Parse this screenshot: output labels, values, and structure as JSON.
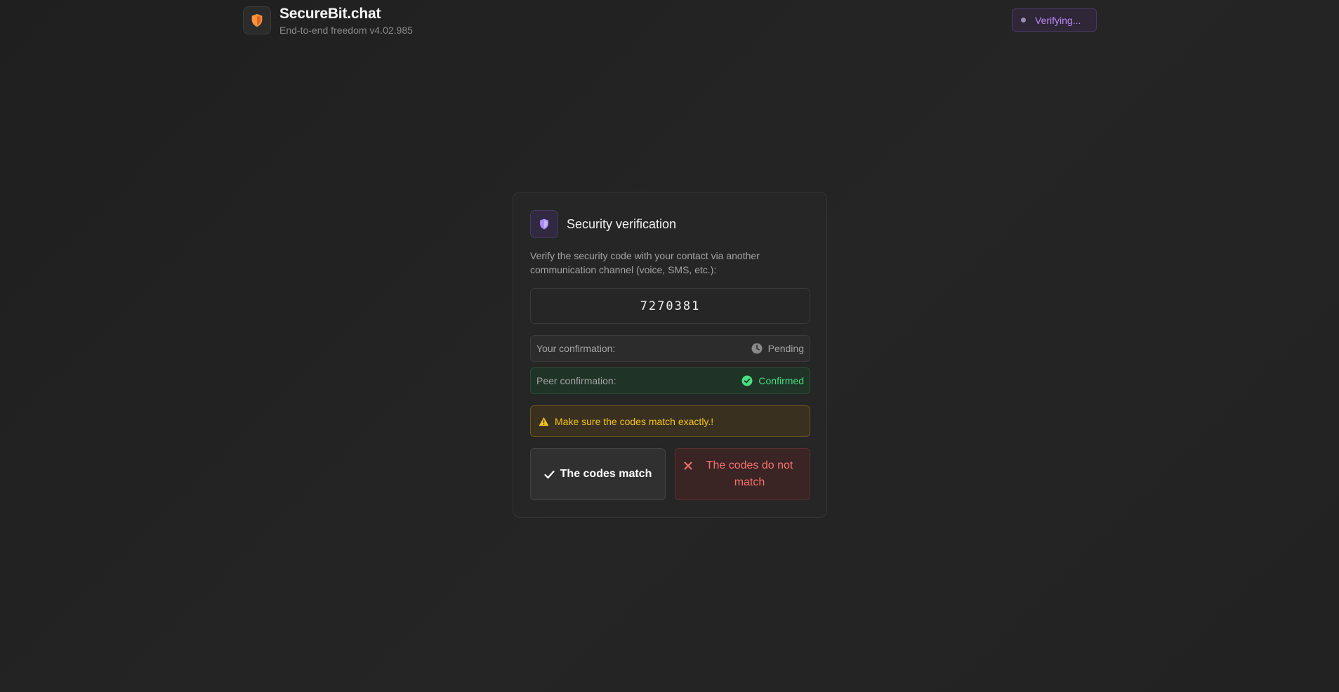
{
  "header": {
    "app_title": "SecureBit.chat",
    "subtitle": "End-to-end freedom v4.02.985",
    "status_text": "Verifying..."
  },
  "verification": {
    "title": "Security verification",
    "description": "Verify the security code with your contact via another communication channel (voice, SMS, etc.):",
    "code": "7270381",
    "your_confirmation_label": "Your confirmation:",
    "your_confirmation_status": "Pending",
    "peer_confirmation_label": "Peer confirmation:",
    "peer_confirmation_status": "Confirmed",
    "warning": "Make sure the codes match exactly.!",
    "match_button": "The codes match",
    "nomatch_button": "The codes do not match"
  },
  "icons": {
    "logo": "shield-icon",
    "card": "shield-icon",
    "pending": "clock-icon",
    "confirmed": "check-circle-icon",
    "warning": "warning-triangle-icon",
    "match": "check-icon",
    "nomatch": "x-icon"
  },
  "colors": {
    "brand_orange": "#fb923c",
    "accent_purple": "#a78bfa",
    "success_green": "#4ade80",
    "warning_yellow": "#f5c518",
    "danger_red": "#f87171"
  }
}
